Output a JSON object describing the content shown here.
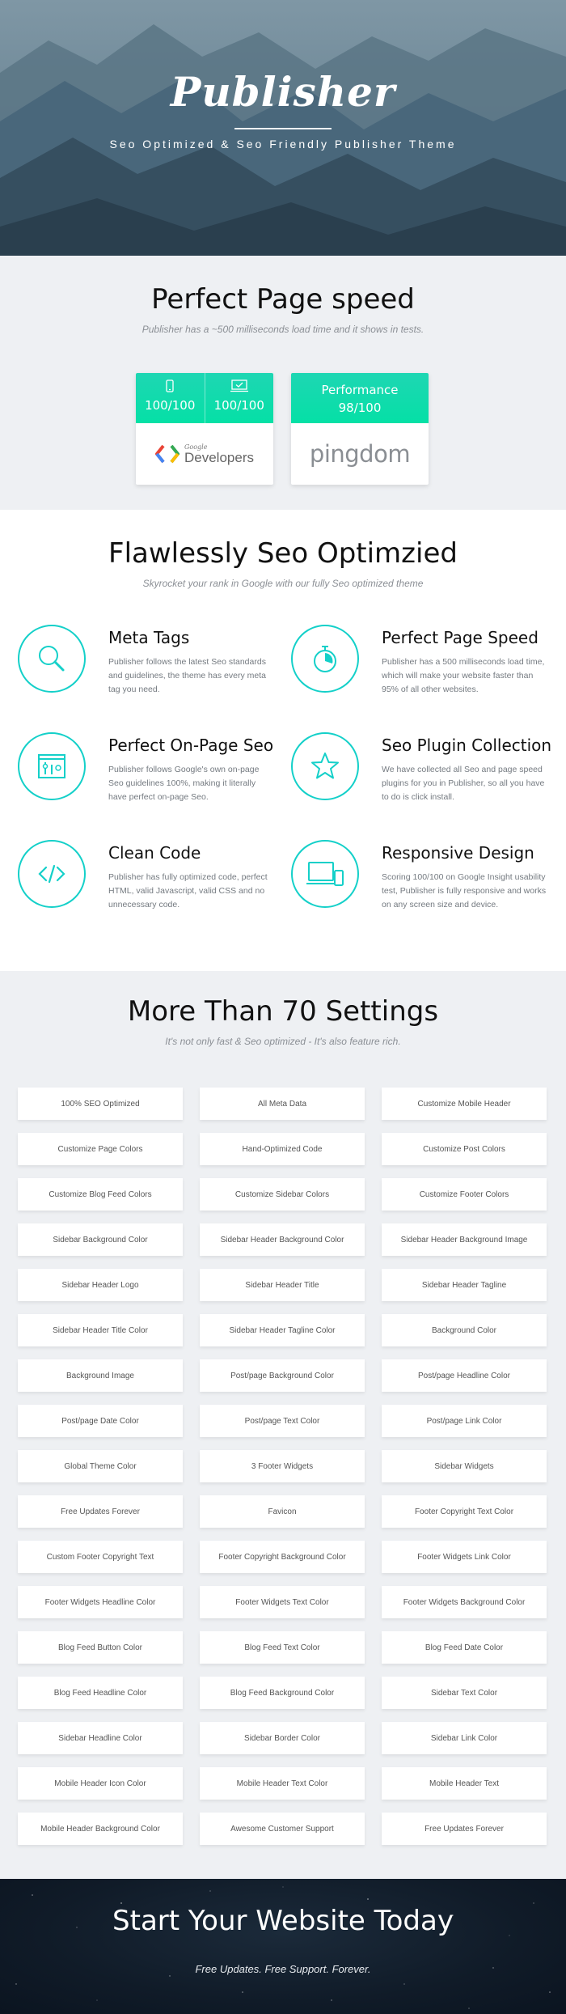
{
  "hero": {
    "brand": "Publisher",
    "tagline": "Seo Optimized & Seo Friendly Publisher Theme"
  },
  "speed": {
    "title": "Perfect Page speed",
    "subtitle": "Publisher has a ~500 milliseconds load time and it shows in tests.",
    "google_card": {
      "mobile_score": "100/100",
      "desktop_score": "100/100",
      "logo_small": "Google",
      "logo_text": "Developers",
      "icons": [
        "mobile-phone-icon",
        "desktop-check-icon"
      ]
    },
    "pingdom_card": {
      "label": "Performance",
      "score": "98/100",
      "logo_text": "pingdom"
    },
    "accent": "#0be0ab"
  },
  "seo": {
    "title": "Flawlessly Seo Optimzied",
    "subtitle": "Skyrocket your rank in Google with our fully Seo optimized theme",
    "accent": "#14d0c9",
    "features": [
      {
        "title": "Meta Tags",
        "desc": "Publisher follows the latest Seo standards and guidelines, the theme has every meta tag you need.",
        "icon": "magnifier-icon"
      },
      {
        "title": "Perfect Page Speed",
        "desc": "Publisher has a 500 milliseconds load time, which will make your website faster than 95% of all other websites.",
        "icon": "stopwatch-icon"
      },
      {
        "title": "Perfect On-Page Seo",
        "desc": "Publisher follows Google's own on-page Seo guidelines 100%, making it literally have perfect on-page Seo.",
        "icon": "browser-tools-icon"
      },
      {
        "title": "Seo Plugin Collection",
        "desc": "We have collected all Seo and page speed plugins for you in Publisher, so all you have to do is click install.",
        "icon": "star-icon"
      },
      {
        "title": "Clean Code",
        "desc": "Publisher has fully optimized code, perfect HTML, valid Javascript, valid CSS and no unnecessary code.",
        "icon": "code-icon"
      },
      {
        "title": "Responsive Design",
        "desc": "Scoring 100/100 on Google Insight usability test, Publisher is fully responsive and works on any screen size and device.",
        "icon": "devices-icon"
      }
    ]
  },
  "settings": {
    "title": "More Than 70 Settings",
    "subtitle": "It's not only fast & Seo optimized - It's also feature rich.",
    "items": [
      "100% SEO Optimized",
      "All Meta Data",
      "Customize Mobile Header",
      "Customize Page Colors",
      "Hand-Optimized Code",
      "Customize Post Colors",
      "Customize Blog Feed Colors",
      "Customize Sidebar Colors",
      "Customize Footer Colors",
      "Sidebar Background Color",
      "Sidebar Header Background Color",
      "Sidebar Header Background Image",
      "Sidebar Header Logo",
      "Sidebar Header Title",
      "Sidebar Header Tagline",
      "Sidebar Header Title Color",
      "Sidebar Header Tagline Color",
      "Background Color",
      "Background Image",
      "Post/page Background Color",
      "Post/page Headline Color",
      "Post/page Date Color",
      "Post/page Text Color",
      "Post/page Link Color",
      "Global Theme Color",
      "3 Footer Widgets",
      "Sidebar Widgets",
      "Free Updates Forever",
      "Favicon",
      "Footer Copyright Text Color",
      "Custom Footer Copyright Text",
      "Footer Copyright Background Color",
      "Footer Widgets Link Color",
      "Footer Widgets Headline Color",
      "Footer Widgets Text Color",
      "Footer Widgets Background Color",
      "Blog Feed Button Color",
      "Blog Feed Text Color",
      "Blog Feed Date Color",
      "Blog Feed Headline Color",
      "Blog Feed Background Color",
      "Sidebar Text Color",
      "Sidebar Headline Color",
      "Sidebar Border Color",
      "Sidebar Link Color",
      "Mobile Header Icon Color",
      "Mobile Header Text Color",
      "Mobile Header Text",
      "Mobile Header Background Color",
      "Awesome Customer Support",
      "Free Updates Forever"
    ]
  },
  "cta": {
    "title": "Start Your Website Today",
    "subtitle": "Free Updates. Free Support. Forever."
  }
}
